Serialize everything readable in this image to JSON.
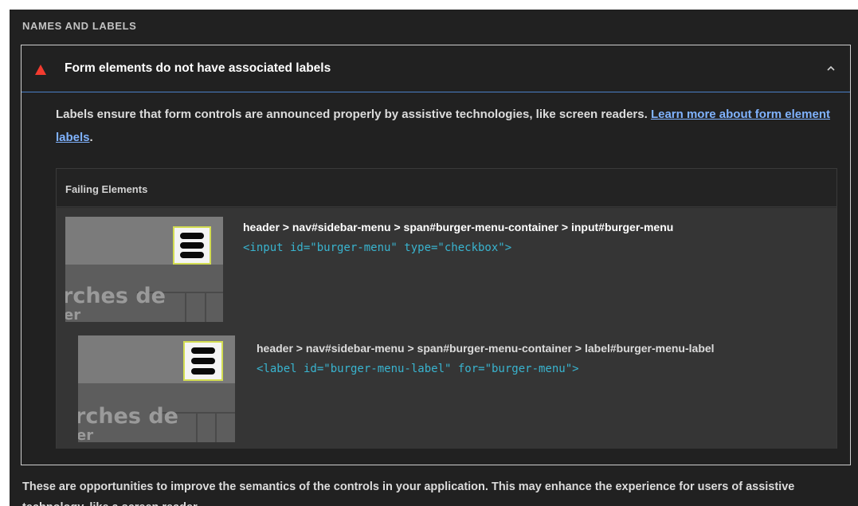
{
  "section": {
    "heading": "NAMES AND LABELS"
  },
  "audit": {
    "title": "Form elements do not have associated labels",
    "status_icon": "warning-triangle-icon",
    "expand_icon": "chevron-up-icon",
    "description_text": "Labels ensure that form controls are announced properly by assistive technologies, like screen readers. ",
    "learn_more_link": "Learn more about form element labels",
    "description_end": ".",
    "details": {
      "heading": "Failing Elements",
      "items": [
        {
          "path": "header > nav#sidebar-menu > span#burger-menu-container > input#burger-menu",
          "snippet": "<input id=\"burger-menu\" type=\"checkbox\">",
          "thumbnail_text": "rches de",
          "thumbnail_text_2": "er"
        },
        {
          "path": "header > nav#sidebar-menu > span#burger-menu-container > label#burger-menu-label",
          "snippet": "<label id=\"burger-menu-label\" for=\"burger-menu\">",
          "thumbnail_text": "rches de",
          "thumbnail_text_2": "er"
        }
      ]
    }
  },
  "footer": {
    "text": "These are opportunities to improve the semantics of the controls in your application. This may enhance the experience for users of assistive technology, like a screen reader."
  },
  "colors": {
    "background": "#212121",
    "fail_red": "#f33b2f",
    "link_blue": "#80b3ff",
    "snippet_cyan": "#39b4cf",
    "highlight_yellow": "#d3dd52"
  }
}
